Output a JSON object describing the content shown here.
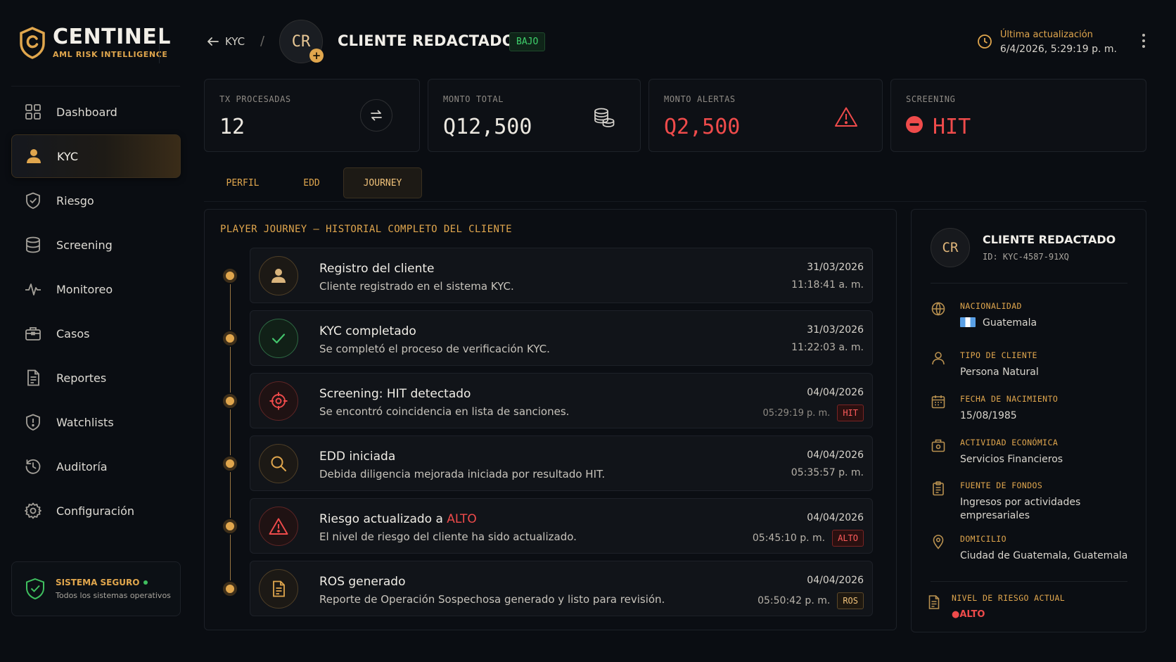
{
  "brand": {
    "name": "CENTINEL",
    "tagline": "AML RISK INTELLIGENCE"
  },
  "sidebar": {
    "items": [
      {
        "label": "Dashboard",
        "icon": "grid-icon",
        "active": false
      },
      {
        "label": "KYC",
        "icon": "user-icon",
        "active": true
      },
      {
        "label": "Riesgo",
        "icon": "shield-check-icon",
        "active": false
      },
      {
        "label": "Screening",
        "icon": "database-icon",
        "active": false
      },
      {
        "label": "Monitoreo",
        "icon": "activity-icon",
        "active": false
      },
      {
        "label": "Casos",
        "icon": "briefcase-icon",
        "active": false
      },
      {
        "label": "Reportes",
        "icon": "document-icon",
        "active": false
      },
      {
        "label": "Watchlists",
        "icon": "shield-alert-icon",
        "active": false
      },
      {
        "label": "Auditoría",
        "icon": "history-icon",
        "active": false
      },
      {
        "label": "Configuración",
        "icon": "gear-icon",
        "active": false
      }
    ],
    "status": {
      "title": "SISTEMA SEGURO",
      "subtitle": "Todos los sistemas operativos"
    }
  },
  "header": {
    "back_label": "KYC",
    "separator": "/",
    "avatar_initials": "CR",
    "client_name": "CLIENTE REDACTADO",
    "risk_badge": "BAJO",
    "last_update_label": "Última actualización",
    "last_update_value": "6/4/2026, 5:29:19 p. m."
  },
  "stats": [
    {
      "label": "TX PROCESADAS",
      "value": "12",
      "icon": "exchange-icon"
    },
    {
      "label": "MONTO TOTAL",
      "value": "Q12,500",
      "icon": "coins-icon"
    },
    {
      "label": "MONTO ALERTAS",
      "value": "Q2,500",
      "icon": "warning-icon"
    },
    {
      "label": "SCREENING",
      "value": "HIT",
      "icon": "block-icon"
    }
  ],
  "tabs": [
    {
      "label": "PERFIL",
      "active": false
    },
    {
      "label": "EDD",
      "active": false
    },
    {
      "label": "JOURNEY",
      "active": true
    }
  ],
  "journey": {
    "title": "PLAYER JOURNEY — HISTORIAL COMPLETO DEL CLIENTE",
    "events": [
      {
        "title": "Registro del cliente",
        "desc": "Cliente registrado en el sistema KYC.",
        "date": "31/03/2026",
        "time": "11:18:41 a. m.",
        "tag": "",
        "icon": "user-icon"
      },
      {
        "title": "KYC completado",
        "desc": "Se completó el proceso de verificación KYC.",
        "date": "31/03/2026",
        "time": "11:22:03 a. m.",
        "tag": "",
        "icon": "check-icon"
      },
      {
        "title": "Screening: HIT detectado",
        "desc": "Se encontró coincidencia en lista de sanciones.",
        "date": "04/04/2026",
        "time": "05:29:19 p. m.",
        "tag": "HIT",
        "icon": "crosshair-icon"
      },
      {
        "title": "EDD iniciada",
        "desc": "Debida diligencia mejorada iniciada por resultado HIT.",
        "date": "04/04/2026",
        "time": "05:35:57 p. m.",
        "tag": "",
        "icon": "search-icon"
      },
      {
        "title": "Riesgo actualizado a ",
        "title_highlight": "ALTO",
        "desc": "El nivel de riesgo del cliente ha sido actualizado.",
        "date": "04/04/2026",
        "time": "05:45:10 p. m.",
        "tag": "ALTO",
        "icon": "warning-icon"
      },
      {
        "title": "ROS generado",
        "desc": "Reporte de Operación Sospechosa generado y listo para revisión.",
        "date": "04/04/2026",
        "time": "05:50:42 p. m.",
        "tag": "ROS",
        "icon": "document-icon"
      }
    ]
  },
  "profile": {
    "initials": "CR",
    "name": "CLIENTE REDACTADO",
    "id": "ID: KYC-4587-91XQ",
    "fields": [
      {
        "label": "NACIONALIDAD",
        "value": "Guatemala",
        "icon": "globe-icon"
      },
      {
        "label": "TIPO DE CLIENTE",
        "value": "Persona Natural",
        "icon": "user-icon"
      },
      {
        "label": "FECHA DE NACIMIENTO",
        "value": "15/08/1985",
        "icon": "calendar-icon"
      },
      {
        "label": "ACTIVIDAD ECONÓMICA",
        "value": "Servicios Financieros",
        "icon": "briefcase-icon"
      },
      {
        "label": "FUENTE DE FONDOS",
        "value": "Ingresos por actividades empresariales",
        "icon": "clipboard-icon"
      },
      {
        "label": "DOMICILIO",
        "value": "Ciudad de Guatemala, Guatemala",
        "icon": "location-icon"
      }
    ],
    "risk_label": "NIVEL DE RIESGO ACTUAL",
    "risk_value": "●ALTO"
  },
  "colors": {
    "accent": "#e0a64d",
    "danger": "#ef4b4b",
    "success": "#3fd16c",
    "background": "#0a0d12"
  }
}
